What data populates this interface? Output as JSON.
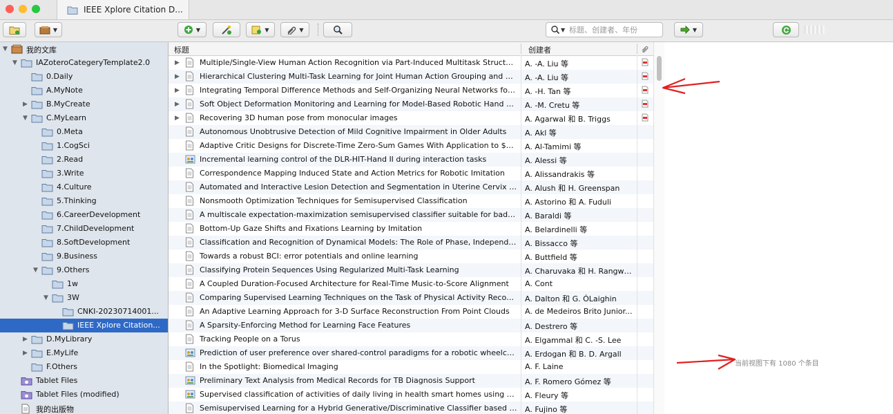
{
  "window": {
    "tab_title": "IEEE Xplore Citation D...",
    "traffic_colors": {
      "close": "#fe5f57",
      "minimize": "#febc2e",
      "zoom": "#28c840"
    }
  },
  "toolbar": {
    "search_placeholder": "标题、创建者、年份"
  },
  "tree": [
    {
      "label": "我的文库",
      "depth": 0,
      "twisty": "open",
      "icon": "library-icon"
    },
    {
      "label": "IAZoteroCategeryTemplate2.0",
      "depth": 1,
      "twisty": "open",
      "icon": "folder-icon"
    },
    {
      "label": "0.Daily",
      "depth": 2,
      "twisty": "",
      "icon": "folder-icon"
    },
    {
      "label": "A.MyNote",
      "depth": 2,
      "twisty": "",
      "icon": "folder-icon"
    },
    {
      "label": "B.MyCreate",
      "depth": 2,
      "twisty": "closed",
      "icon": "folder-icon"
    },
    {
      "label": "C.MyLearn",
      "depth": 2,
      "twisty": "open",
      "icon": "folder-icon"
    },
    {
      "label": "0.Meta",
      "depth": 3,
      "twisty": "",
      "icon": "folder-icon"
    },
    {
      "label": "1.CogSci",
      "depth": 3,
      "twisty": "",
      "icon": "folder-icon"
    },
    {
      "label": "2.Read",
      "depth": 3,
      "twisty": "",
      "icon": "folder-icon"
    },
    {
      "label": "3.Write",
      "depth": 3,
      "twisty": "",
      "icon": "folder-icon"
    },
    {
      "label": "4.Culture",
      "depth": 3,
      "twisty": "",
      "icon": "folder-icon"
    },
    {
      "label": "5.Thinking",
      "depth": 3,
      "twisty": "",
      "icon": "folder-icon"
    },
    {
      "label": "6.CareerDevelopment",
      "depth": 3,
      "twisty": "",
      "icon": "folder-icon"
    },
    {
      "label": "7.ChildDevelopment",
      "depth": 3,
      "twisty": "",
      "icon": "folder-icon"
    },
    {
      "label": "8.SoftDevelopment",
      "depth": 3,
      "twisty": "",
      "icon": "folder-icon"
    },
    {
      "label": "9.Business",
      "depth": 3,
      "twisty": "",
      "icon": "folder-icon"
    },
    {
      "label": "9.Others",
      "depth": 3,
      "twisty": "open",
      "icon": "folder-icon"
    },
    {
      "label": "1w",
      "depth": 4,
      "twisty": "",
      "icon": "folder-icon"
    },
    {
      "label": "3W",
      "depth": 4,
      "twisty": "open",
      "icon": "folder-icon"
    },
    {
      "label": "CNKI-20230714001...",
      "depth": 5,
      "twisty": "",
      "icon": "folder-icon"
    },
    {
      "label": "IEEE Xplore Citation...",
      "depth": 5,
      "twisty": "",
      "icon": "folder-icon",
      "selected": true
    },
    {
      "label": "D.MyLibrary",
      "depth": 2,
      "twisty": "closed",
      "icon": "folder-icon"
    },
    {
      "label": "E.MyLife",
      "depth": 2,
      "twisty": "closed",
      "icon": "folder-icon"
    },
    {
      "label": "F.Others",
      "depth": 2,
      "twisty": "",
      "icon": "folder-icon"
    },
    {
      "label": "Tablet Files",
      "depth": 1,
      "twisty": "",
      "icon": "tablet-icon"
    },
    {
      "label": "Tablet Files (modified)",
      "depth": 1,
      "twisty": "",
      "icon": "tablet-icon"
    },
    {
      "label": "我的出版物",
      "depth": 1,
      "twisty": "",
      "icon": "publication-icon"
    }
  ],
  "columns": {
    "title": "标题",
    "creator": "创建者"
  },
  "items": [
    {
      "title": "Multiple/Single-View Human Action Recognition via Part-Induced Multitask Structur...",
      "creator": "A. -A. Liu 等",
      "expand": true,
      "pdf": true,
      "type": "document"
    },
    {
      "title": "Hierarchical Clustering Multi-Task Learning for Joint Human Action Grouping and R...",
      "creator": "A. -A. Liu 等",
      "expand": true,
      "pdf": true,
      "type": "document"
    },
    {
      "title": "Integrating Temporal Difference Methods and Self-Organizing Neural Networks for ...",
      "creator": "A. -H. Tan 等",
      "expand": true,
      "pdf": true,
      "type": "document"
    },
    {
      "title": "Soft Object Deformation Monitoring and Learning for Model-Based Robotic Hand M...",
      "creator": "A. -M. Cretu 等",
      "expand": true,
      "pdf": true,
      "type": "document"
    },
    {
      "title": "Recovering 3D human pose from monocular images",
      "creator": "A. Agarwal 和 B. Triggs",
      "expand": true,
      "pdf": true,
      "type": "document"
    },
    {
      "title": "Autonomous Unobtrusive Detection of Mild Cognitive Impairment in Older Adults",
      "creator": "A. Akl 等",
      "expand": false,
      "pdf": false,
      "type": "document"
    },
    {
      "title": "Adaptive Critic Designs for Discrete-Time Zero-Sum Games With Application to $H_...",
      "creator": "A. Al-Tamimi 等",
      "expand": false,
      "pdf": false,
      "type": "document"
    },
    {
      "title": "Incremental learning control of the DLR-HIT-Hand II during interaction tasks",
      "creator": "A. Alessi 等",
      "expand": false,
      "pdf": false,
      "type": "conference"
    },
    {
      "title": "Correspondence Mapping Induced State and Action Metrics for Robotic Imitation",
      "creator": "A. Alissandrakis 等",
      "expand": false,
      "pdf": false,
      "type": "document"
    },
    {
      "title": "Automated and Interactive Lesion Detection and Segmentation in Uterine Cervix Ima...",
      "creator": "A. Alush 和 H. Greenspan",
      "expand": false,
      "pdf": false,
      "type": "document"
    },
    {
      "title": "Nonsmooth Optimization Techniques for Semisupervised Classification",
      "creator": "A. Astorino 和 A. Fuduli",
      "expand": false,
      "pdf": false,
      "type": "document"
    },
    {
      "title": "A multiscale expectation-maximization semisupervised classifier suitable for badly ...",
      "creator": "A. Baraldi 等",
      "expand": false,
      "pdf": false,
      "type": "document"
    },
    {
      "title": "Bottom-Up Gaze Shifts and Fixations Learning by Imitation",
      "creator": "A. Belardinelli 等",
      "expand": false,
      "pdf": false,
      "type": "document"
    },
    {
      "title": "Classification and Recognition of Dynamical Models: The Role of Phase, Independen...",
      "creator": "A. Bissacco 等",
      "expand": false,
      "pdf": false,
      "type": "document"
    },
    {
      "title": "Towards a robust BCI: error potentials and online learning",
      "creator": "A. Buttfield 等",
      "expand": false,
      "pdf": false,
      "type": "document"
    },
    {
      "title": "Classifying Protein Sequences Using Regularized Multi-Task Learning",
      "creator": "A. Charuvaka 和 H. Rangwala",
      "expand": false,
      "pdf": false,
      "type": "document"
    },
    {
      "title": "A Coupled Duration-Focused Architecture for Real-Time Music-to-Score Alignment",
      "creator": "A. Cont",
      "expand": false,
      "pdf": false,
      "type": "document"
    },
    {
      "title": "Comparing Supervised Learning Techniques on the Task of Physical Activity Recogni...",
      "creator": "A. Dalton 和 G. ÓLaighin",
      "expand": false,
      "pdf": false,
      "type": "document"
    },
    {
      "title": "An Adaptive Learning Approach for 3-D Surface Reconstruction From Point Clouds",
      "creator": "A. de Medeiros Brito Junior...",
      "expand": false,
      "pdf": false,
      "type": "document"
    },
    {
      "title": "A Sparsity-Enforcing Method for Learning Face Features",
      "creator": "A. Destrero 等",
      "expand": false,
      "pdf": false,
      "type": "document"
    },
    {
      "title": "Tracking People on a Torus",
      "creator": "A. Elgammal 和 C. -S. Lee",
      "expand": false,
      "pdf": false,
      "type": "document"
    },
    {
      "title": "Prediction of user preference over shared-control paradigms for a robotic wheelchair",
      "creator": "A. Erdogan 和 B. D. Argall",
      "expand": false,
      "pdf": false,
      "type": "conference"
    },
    {
      "title": "In the Spotlight: Biomedical Imaging",
      "creator": "A. F. Laine",
      "expand": false,
      "pdf": false,
      "type": "document"
    },
    {
      "title": "Preliminary Text Analysis from Medical Records for TB Diagnosis Support",
      "creator": "A. F. Romero Gómez 等",
      "expand": false,
      "pdf": false,
      "type": "conference"
    },
    {
      "title": "Supervised classification of activities of daily living in health smart homes using SVM",
      "creator": "A. Fleury 等",
      "expand": false,
      "pdf": false,
      "type": "conference"
    },
    {
      "title": "Semisupervised Learning for a Hybrid Generative/Discriminative Classifier based on ...",
      "creator": "A. Fujino 等",
      "expand": false,
      "pdf": false,
      "type": "document"
    }
  ],
  "right_pane": {
    "count_text": "当前视图下有 1080 个条目"
  }
}
